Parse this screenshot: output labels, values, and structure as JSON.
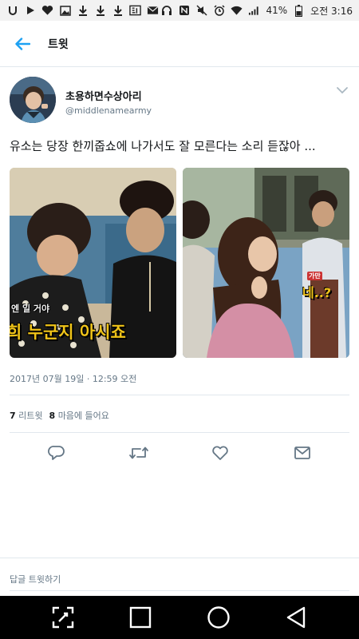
{
  "status_bar": {
    "battery": "41%",
    "time": "오전 3:16",
    "icons": [
      "u-icon",
      "play-icon",
      "heart-icon",
      "image-icon",
      "download-icon",
      "download-icon",
      "download-icon",
      "app-icon",
      "mail-icon",
      "headphones-icon",
      "nfc-icon",
      "mute-icon",
      "alarm-icon",
      "wifi-icon",
      "signal-icon",
      "battery-icon"
    ]
  },
  "header": {
    "title": "트윗"
  },
  "tweet": {
    "display_name": "초용하면수상아리",
    "handle": "@middlenamearmy",
    "text": "유소는 당장 한끼줍쇼에 나가서도 잘 모른다는 소리 듣잖아 ...",
    "photo_left_caption_top": "엔 일 거야",
    "photo_left_caption": "희 누군지 아시죠",
    "photo_right_caption": "네..?",
    "photo_right_tag": "가만",
    "timestamp": "2017년 07월 19일 · 12:59 오전",
    "retweets": {
      "count": "7",
      "label": "리트윗"
    },
    "likes": {
      "count": "8",
      "label": "마음에 들어요"
    }
  },
  "reply": {
    "placeholder": "답글 트윗하기"
  },
  "colors": {
    "accent": "#1da1f2",
    "text": "#14171a",
    "muted": "#657786",
    "border": "#e1e8ed"
  }
}
